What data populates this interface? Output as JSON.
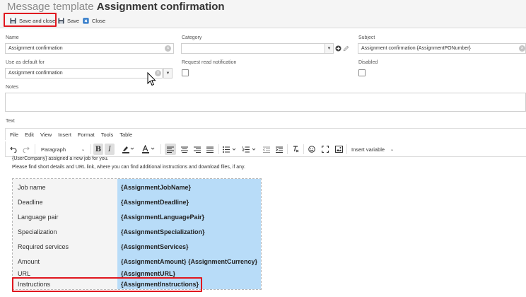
{
  "window": {
    "title_prefix": "Message template",
    "title": "Assignment confirmation"
  },
  "toolbar": {
    "save_and_close_label": "Save and close",
    "save_label": "Save",
    "close_label": "Close"
  },
  "form": {
    "name": {
      "label": "Name",
      "value": "Assignment confirmation"
    },
    "category": {
      "label": "Category",
      "value": ""
    },
    "subject": {
      "label": "Subject",
      "value": "Assignment confirmation {AssignmentPONumber}"
    },
    "use_as_default_for": {
      "label": "Use as default for",
      "value": "Assignment confirmation"
    },
    "request_read_notification": {
      "label": "Request read notification",
      "checked": false
    },
    "disabled": {
      "label": "Disabled",
      "checked": false
    },
    "notes": {
      "label": "Notes",
      "value": ""
    },
    "text": {
      "label": "Text"
    }
  },
  "editor": {
    "menu": [
      "File",
      "Edit",
      "View",
      "Insert",
      "Format",
      "Tools",
      "Table"
    ],
    "block_format": "Paragraph",
    "insert_variable_label": "Insert variable"
  },
  "content": {
    "line1": "{UserCompany} assigned a new job for you.",
    "line2": "Please find short details and URL link, where you can find additional instructions and download files, if any.",
    "rows": [
      {
        "label": "Job name",
        "value": "{AssignmentJobName}"
      },
      {
        "label": "Deadline",
        "value": "{AssignmentDeadline}"
      },
      {
        "label": "Language pair",
        "value": "{AssignmentLanguagePair}"
      },
      {
        "label": "Specialization",
        "value": "{AssignmentSpecialization}"
      },
      {
        "label": "Required services",
        "value": "{AssignmentServices}"
      },
      {
        "label": "Amount",
        "value": "{AssignmentAmount} {AssignmentCurrency}"
      },
      {
        "label": "URL",
        "value": "{AssignmentURL}"
      },
      {
        "label": "Instructions",
        "value": "{AssignmentInstructions}"
      }
    ]
  },
  "colors": {
    "highlight": "#e0171f",
    "value_cell": "#b8dcf8",
    "close_icon": "#1f6fc5"
  }
}
